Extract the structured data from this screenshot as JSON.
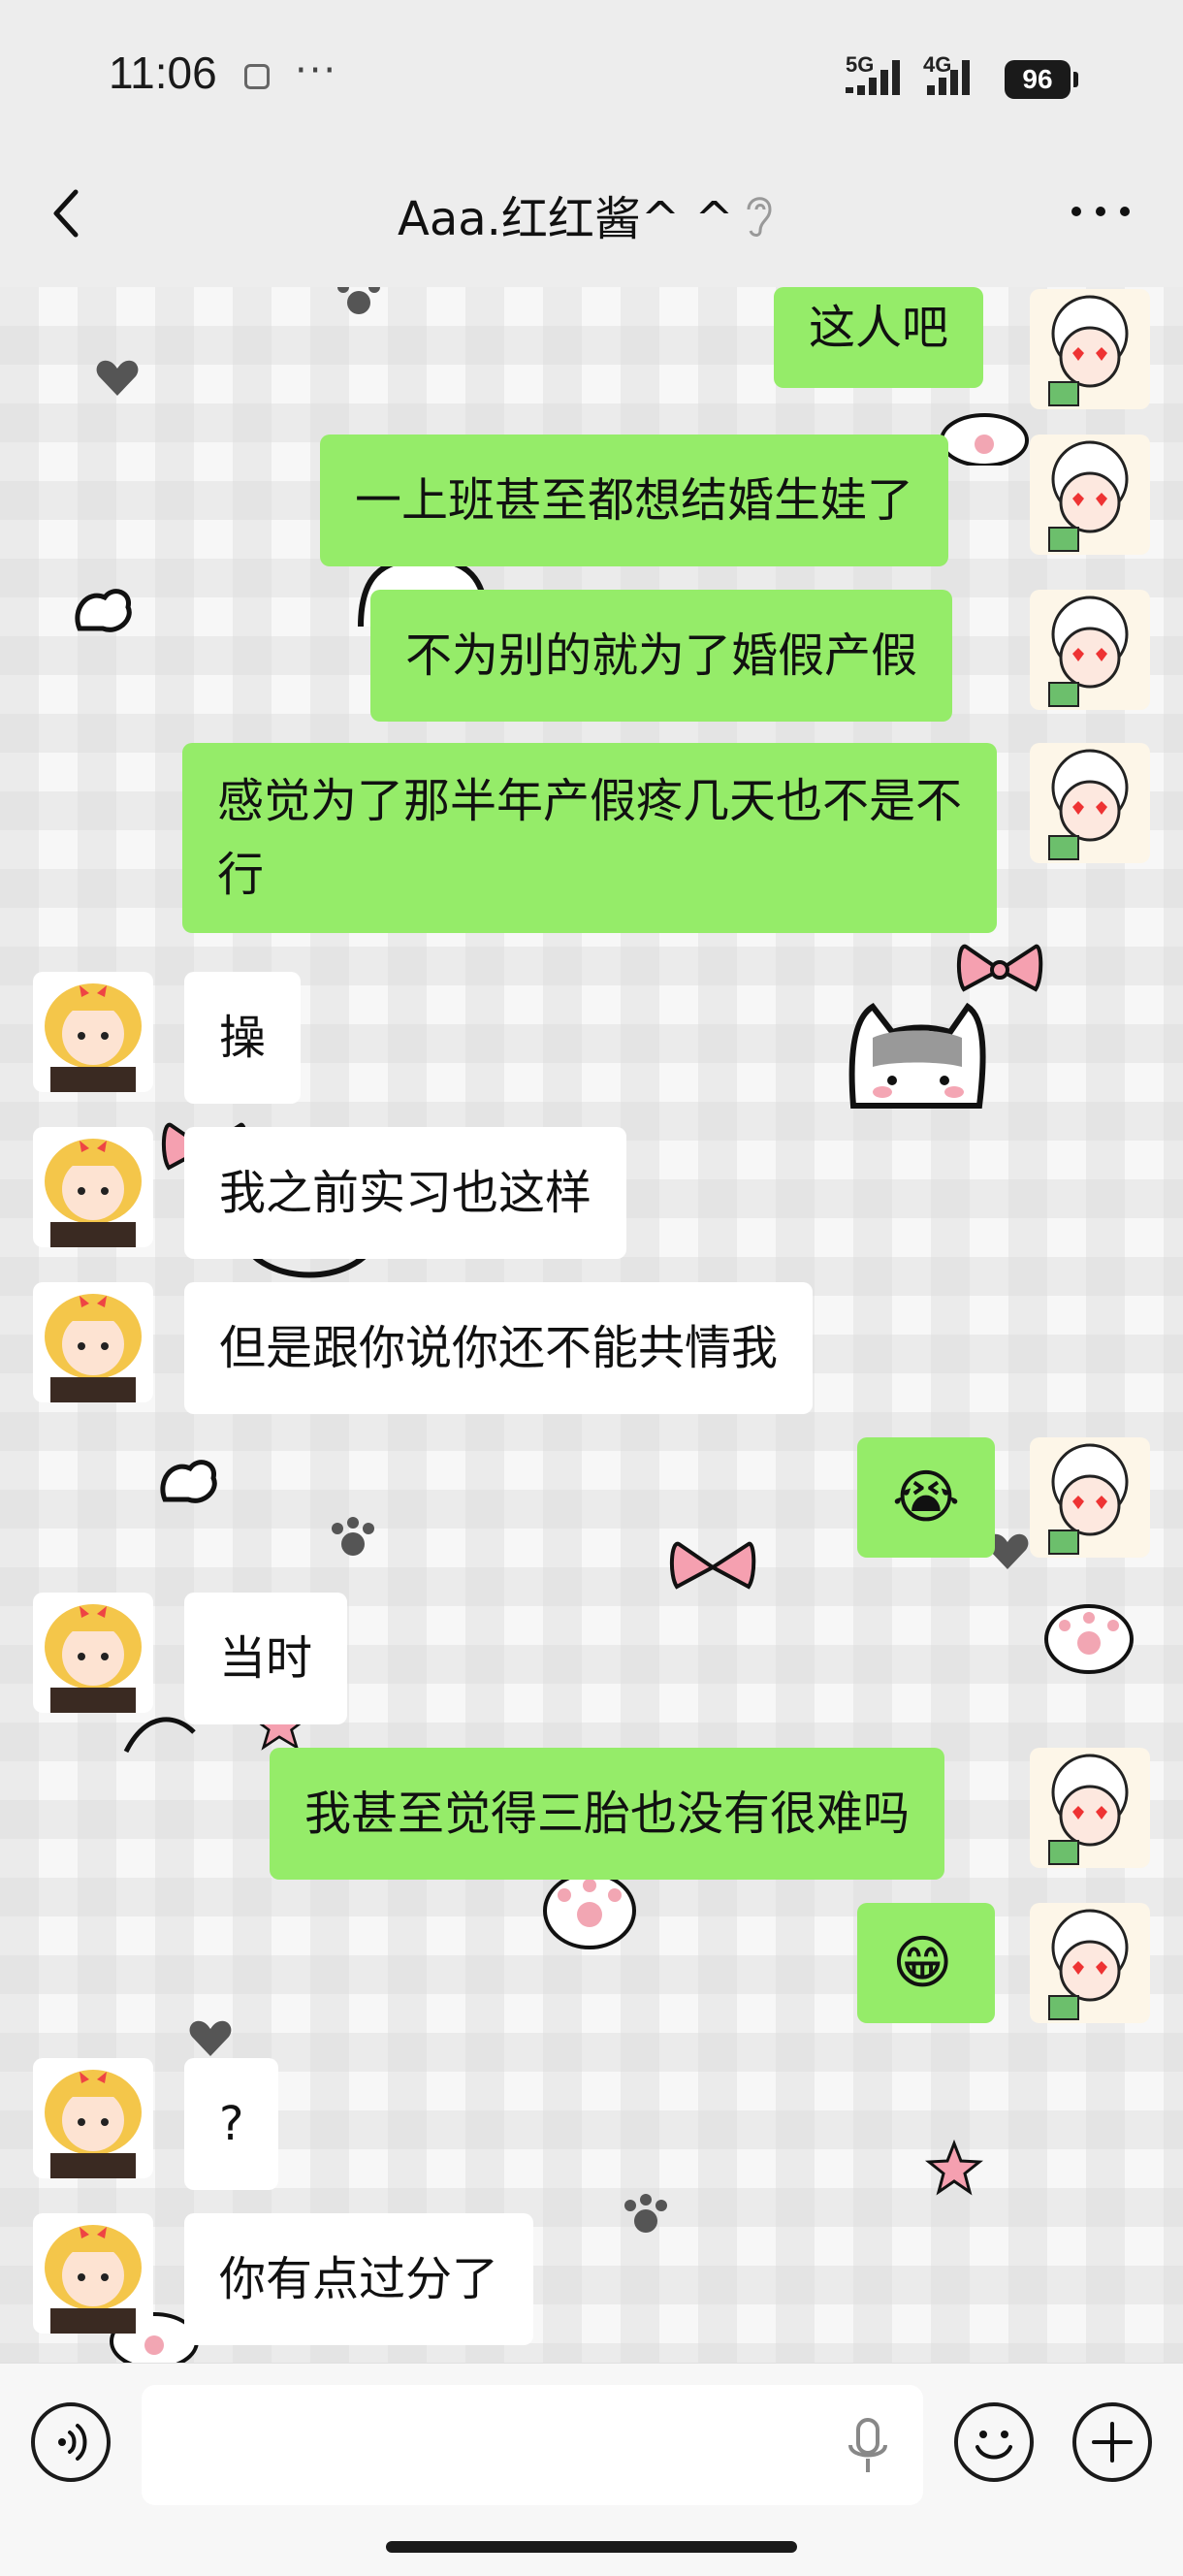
{
  "status_bar": {
    "time": "11:06",
    "more": "···",
    "network_1": "5G",
    "network_2": "4G",
    "battery": "96"
  },
  "header": {
    "title": "Aaa.红红酱^ ^"
  },
  "messages": [
    {
      "sender": "me",
      "type": "text",
      "text": "这人吧"
    },
    {
      "sender": "me",
      "type": "text",
      "text": "一上班甚至都想结婚生娃了"
    },
    {
      "sender": "me",
      "type": "text",
      "text": "不为别的就为了婚假产假"
    },
    {
      "sender": "me",
      "type": "text",
      "text": "感觉为了那半年产假疼几天也不是不行"
    },
    {
      "sender": "them",
      "type": "text",
      "text": "操"
    },
    {
      "sender": "them",
      "type": "text",
      "text": "我之前实习也这样"
    },
    {
      "sender": "them",
      "type": "text",
      "text": "但是跟你说你还不能共情我"
    },
    {
      "sender": "me",
      "type": "emoji",
      "emoji": "😭"
    },
    {
      "sender": "them",
      "type": "text",
      "text": "当时"
    },
    {
      "sender": "me",
      "type": "text",
      "text": "我甚至觉得三胎也没有很难吗"
    },
    {
      "sender": "me",
      "type": "emoji",
      "emoji": "😁"
    },
    {
      "sender": "them",
      "type": "text",
      "text": "?"
    },
    {
      "sender": "them",
      "type": "text",
      "text": "你有点过分了"
    }
  ],
  "input_bar": {
    "text_value": ""
  },
  "colors": {
    "my_bubble": "#95ec69",
    "their_bubble": "#ffffff",
    "background": "#ededed"
  }
}
